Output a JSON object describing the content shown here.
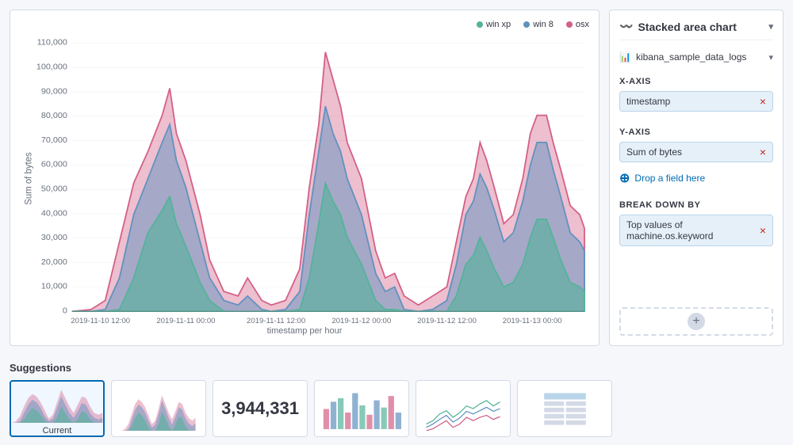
{
  "header": {
    "chart_type": "Stacked area chart",
    "chart_icon": "📊",
    "datasource": "kibana_sample_data_logs"
  },
  "legend": {
    "items": [
      {
        "label": "win xp",
        "color": "#54b399"
      },
      {
        "label": "win 8",
        "color": "#6092c0"
      },
      {
        "label": "osx",
        "color": "#d36086"
      }
    ]
  },
  "axes": {
    "x_label": "X-axis",
    "x_field": "timestamp",
    "y_label": "Y-axis",
    "y_field": "Sum of bytes",
    "drop_label": "Drop a field here",
    "breakdown_label": "Break down by",
    "breakdown_field": "Top values of\nmachine.os.keyword"
  },
  "chart": {
    "y_axis_label": "Sum of bytes",
    "x_axis_label": "timestamp per hour",
    "y_ticks": [
      "110,000",
      "100,000",
      "90,000",
      "80,000",
      "70,000",
      "60,000",
      "50,000",
      "40,000",
      "30,000",
      "20,000",
      "10,000",
      "0"
    ],
    "x_ticks": [
      "2019-11-10 12:00",
      "2019-11-11 00:00",
      "2019-11-11 12:00",
      "2019-11-12 00:00",
      "2019-11-12 12:00",
      "2019-11-13 00:00"
    ]
  },
  "suggestions": {
    "title": "Suggestions",
    "cards": [
      {
        "type": "mini-chart",
        "label": "Current",
        "active": true
      },
      {
        "type": "mini-chart",
        "label": "",
        "active": false
      },
      {
        "type": "number",
        "value": "3,944,331",
        "label": "",
        "active": false
      },
      {
        "type": "mini-chart",
        "label": "",
        "active": false
      },
      {
        "type": "mini-chart",
        "label": "",
        "active": false
      },
      {
        "type": "table",
        "label": "",
        "active": false
      }
    ]
  }
}
